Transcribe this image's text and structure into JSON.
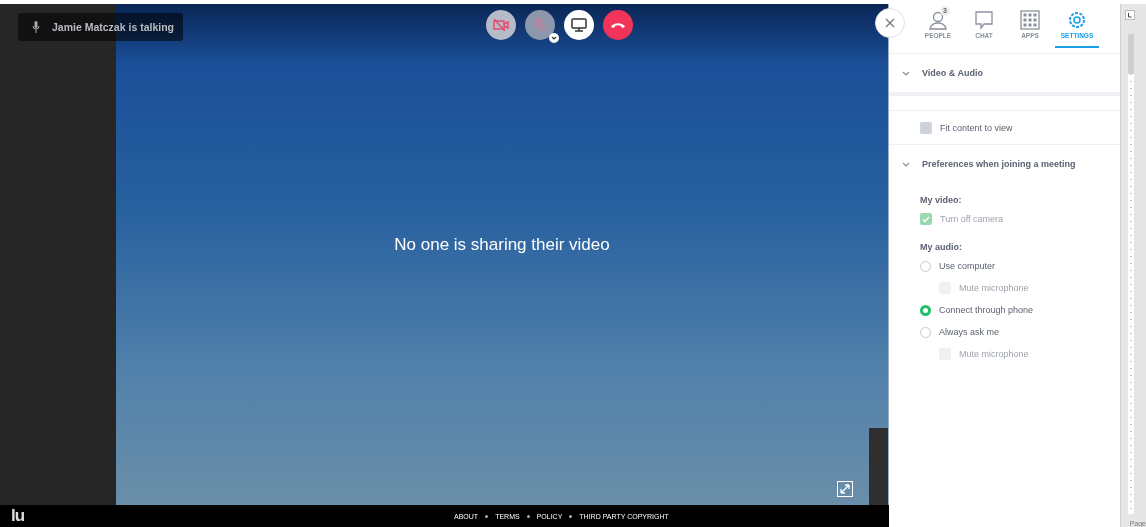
{
  "speaker": {
    "text": "Jamie Matczak is talking"
  },
  "call_controls": [
    {
      "kind": "camera"
    },
    {
      "kind": "mic"
    },
    {
      "kind": "screen"
    },
    {
      "kind": "hangup"
    }
  ],
  "message": "No one is sharing their video",
  "footer": {
    "logo": "lu",
    "links": [
      "ABOUT",
      "TERMS",
      "POLICY",
      "THIRD PARTY COPYRIGHT"
    ]
  },
  "tabs": [
    {
      "kind": "people",
      "label": "PEOPLE",
      "badge": "3",
      "selected": false
    },
    {
      "kind": "chat",
      "label": "CHAT",
      "selected": false
    },
    {
      "kind": "apps",
      "label": "APPS",
      "selected": false
    },
    {
      "kind": "settings",
      "label": "SETTINGS",
      "selected": true
    }
  ],
  "settings": [
    {
      "kind": "section",
      "label": "Video & Audio"
    },
    {
      "kind": "checkbox",
      "label": "Fit content to view",
      "checked": false,
      "disabled": false
    },
    {
      "kind": "section",
      "label": "Preferences when joining a meeting"
    },
    {
      "kind": "heading",
      "label": "My video:"
    },
    {
      "kind": "checkbox",
      "label": "Turn off camera",
      "checked": true,
      "disabled": true
    },
    {
      "kind": "heading",
      "label": "My audio:"
    },
    {
      "kind": "radio",
      "label": "Use computer",
      "selected": false,
      "children": [
        {
          "kind": "checkbox",
          "label": "Mute microphone",
          "checked": false,
          "disabled": true
        }
      ]
    },
    {
      "kind": "radio",
      "label": "Connect through phone",
      "selected": true
    },
    {
      "kind": "radio",
      "label": "Always ask me",
      "selected": false,
      "children": [
        {
          "kind": "checkbox",
          "label": "Mute microphone",
          "checked": false,
          "disabled": true
        }
      ]
    }
  ],
  "ruler": {
    "page_label": "Page"
  }
}
